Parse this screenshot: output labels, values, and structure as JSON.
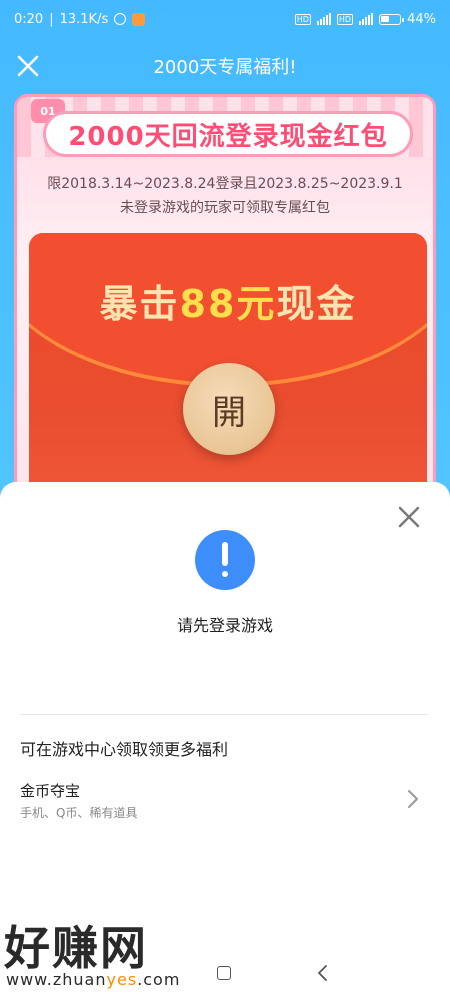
{
  "statusbar": {
    "time": "0:20",
    "net_speed": "13.1K/s",
    "battery": "44%"
  },
  "navbar": {
    "title": "2000天专属福利!"
  },
  "banner": {
    "badge": "01",
    "title": "2000天回流登录现金红包",
    "line1": "限2018.3.14~2023.8.24登录且2023.8.25~2023.9.1",
    "line2": "未登录游戏的玩家可领取专属红包",
    "headline_pre": "暴击",
    "headline_amount": "88元",
    "headline_post": "现金",
    "open_label": "開"
  },
  "sheet": {
    "message": "请先登录游戏",
    "more_title": "可在游戏中心领取领更多福利",
    "items": [
      {
        "name": "金币夺宝",
        "desc": "手机、Q币、稀有道具"
      }
    ]
  },
  "watermark": {
    "big": "好赚网",
    "url_pre": "www.zhuan",
    "url_mid": "yes",
    "url_post": ".com"
  },
  "colors": {
    "primary_blue": "#3d8dfb",
    "header_blue": "#4fc3ff",
    "banner_pink": "#ff4d75",
    "packet_red": "#f04a2c"
  }
}
